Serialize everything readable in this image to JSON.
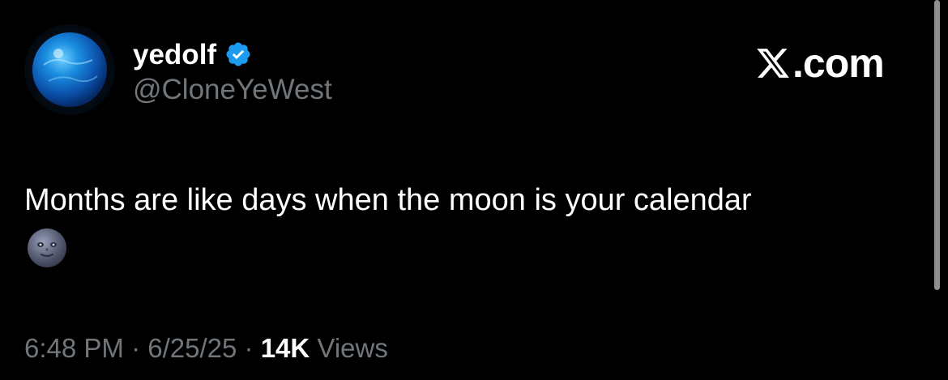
{
  "author": {
    "display_name": "yedolf",
    "handle": "@CloneYeWest",
    "verified": true,
    "avatar_icon": "blue-planet-avatar"
  },
  "site": {
    "logo_icon": "x-logo-icon",
    "suffix": ".com"
  },
  "tweet": {
    "text": "Months are like days when the moon is your calendar",
    "emoji_icon": "new-moon-face-emoji"
  },
  "meta": {
    "time": "6:48 PM",
    "separator": "·",
    "date": "6/25/25",
    "views_count": "14K",
    "views_label": "Views"
  },
  "colors": {
    "background": "#000000",
    "primary_text": "#ffffff",
    "secondary_text": "#71767b",
    "verified_badge": "#1d9bf0"
  }
}
